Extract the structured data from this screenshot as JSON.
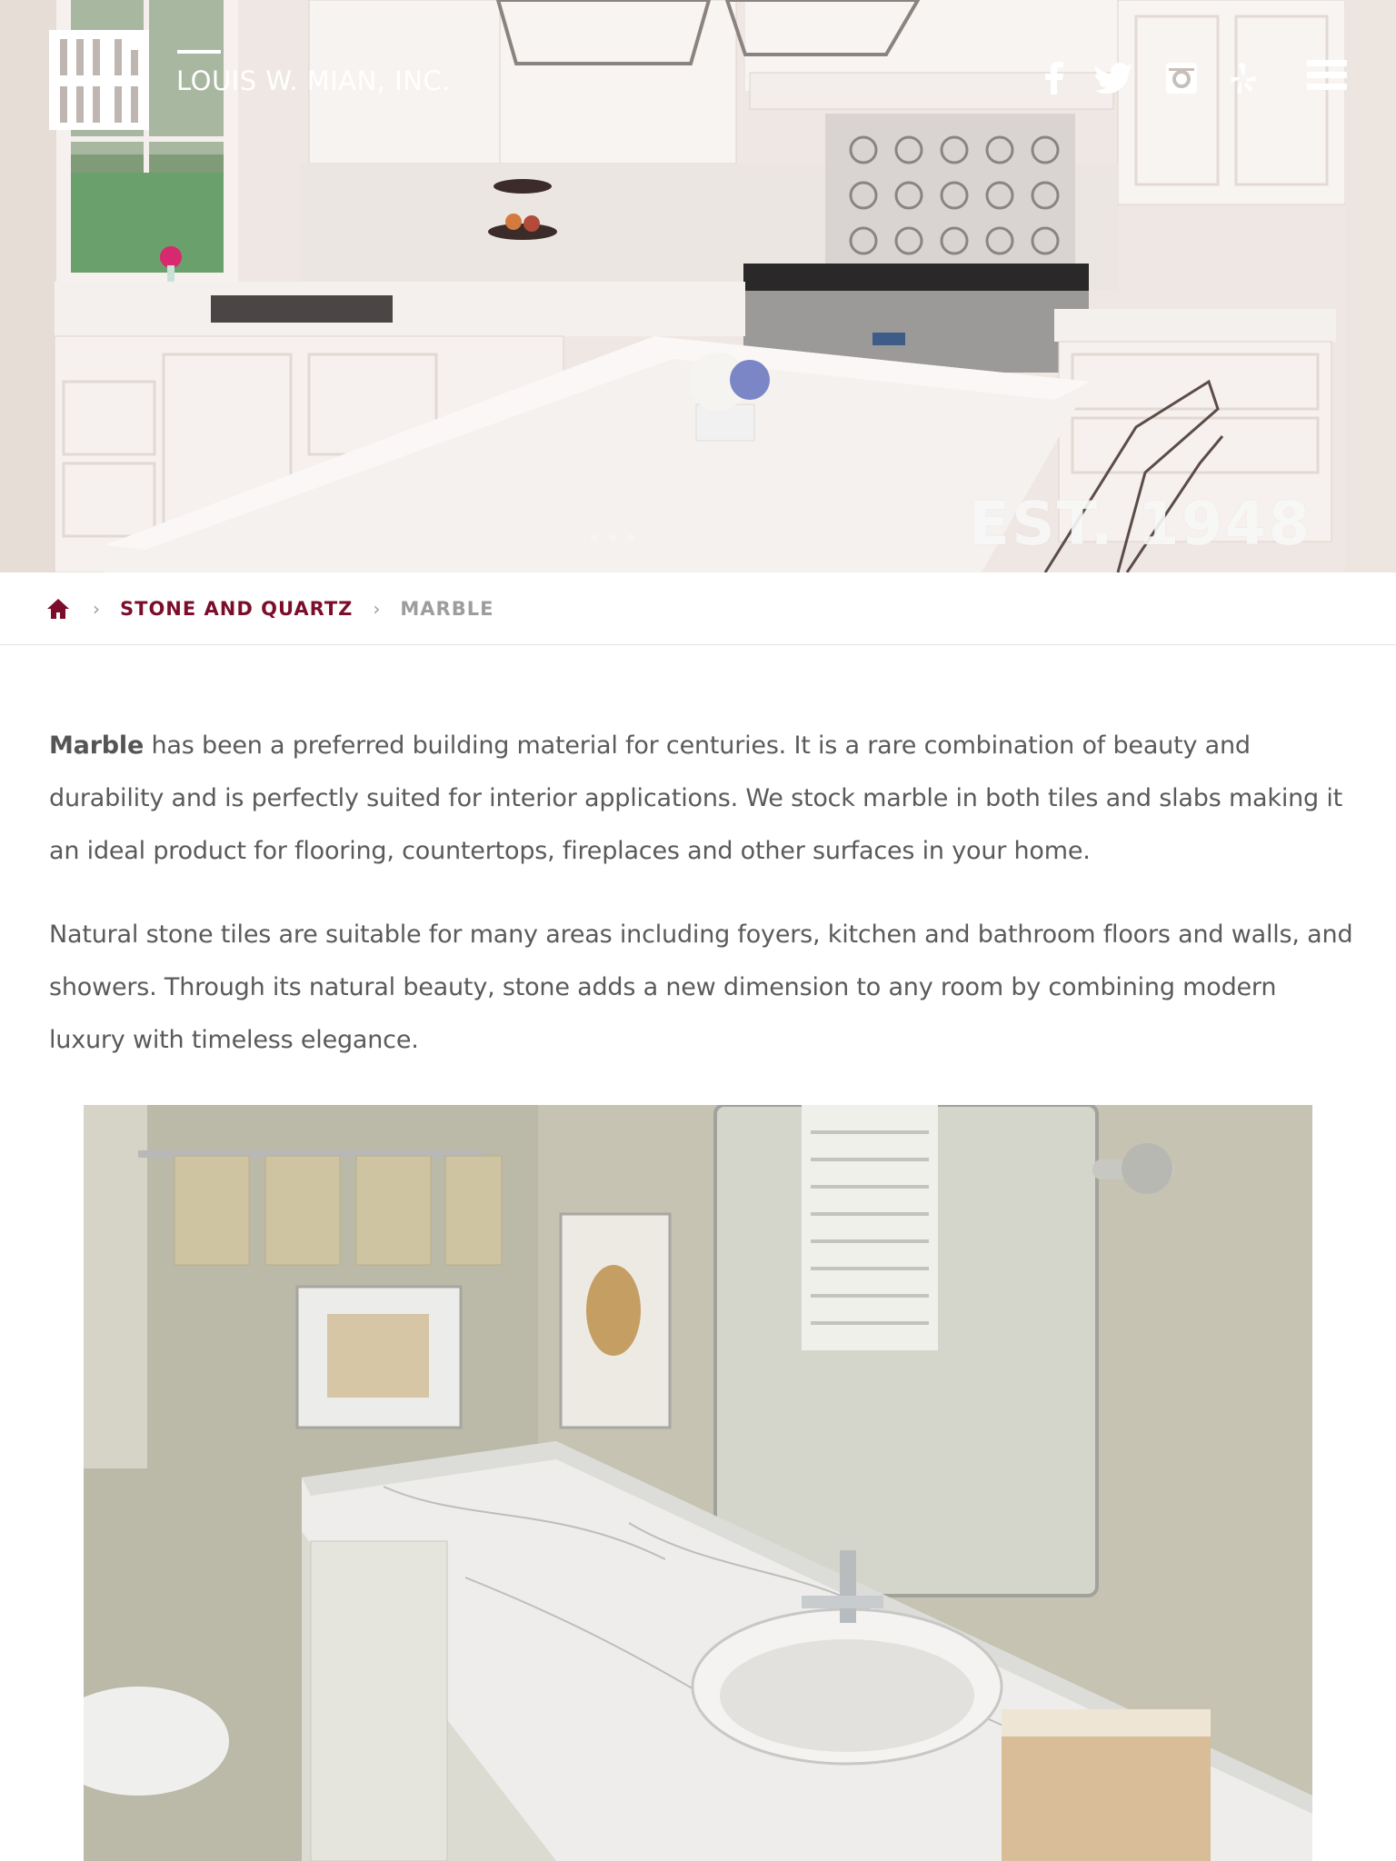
{
  "header": {
    "brand_name": "LOUIS W. MIAN, INC.",
    "logo_icon": "mian-logo",
    "social": [
      {
        "name": "facebook",
        "icon": "facebook-icon"
      },
      {
        "name": "twitter",
        "icon": "twitter-icon"
      },
      {
        "name": "instagram",
        "icon": "instagram-icon"
      },
      {
        "name": "yelp",
        "icon": "yelp-icon"
      }
    ],
    "menu_icon": "hamburger-menu-icon"
  },
  "hero": {
    "badge": "EST. 1948"
  },
  "breadcrumb": {
    "home_icon": "home-icon",
    "items": [
      {
        "label": "STONE AND QUARTZ"
      },
      {
        "label": "MARBLE"
      }
    ]
  },
  "content": {
    "paragraph1_lead": "Marble",
    "paragraph1_rest": " has been a preferred building material for centuries. It is a rare combination of beauty and durability and is perfectly suited for interior applications. We stock marble in both tiles and slabs making it an ideal product for flooring, countertops, fireplaces and other surfaces in your home.",
    "paragraph2": "Natural stone tiles are suitable for many areas including foyers, kitchen and bathroom floors and walls, and showers. Through its natural beauty, stone adds a new dimension to any room by combining modern luxury with timeless elegance."
  },
  "colors": {
    "accent": "#7b0d2a",
    "breadcrumb_current": "#9d9d9d",
    "body_text": "#5a5a5a"
  }
}
